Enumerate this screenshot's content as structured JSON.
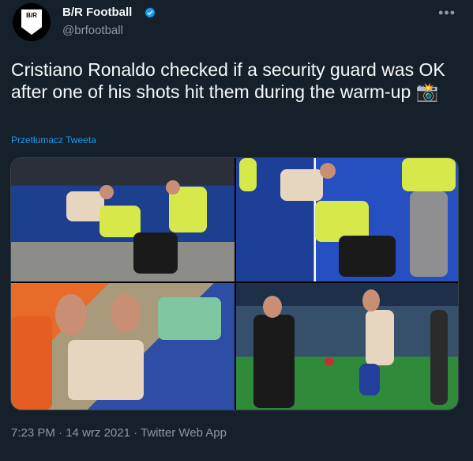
{
  "tweet": {
    "author_name": "B/R Football",
    "handle": "@brfootball",
    "avatar_text": "B/R",
    "text": "Cristiano Ronaldo checked if a security guard was OK after one of his shots hit them during the warm-up 📸",
    "translate_label": "Przetłumacz Tweeta",
    "time": "7:23 PM",
    "date": "14 wrz 2021",
    "source": "Twitter Web App",
    "separator": "·"
  },
  "colors": {
    "background": "#15202b",
    "text_primary": "#f7f9f9",
    "text_secondary": "#8b98a5",
    "link": "#1d9bf0",
    "verified": "#1d9bf0"
  }
}
